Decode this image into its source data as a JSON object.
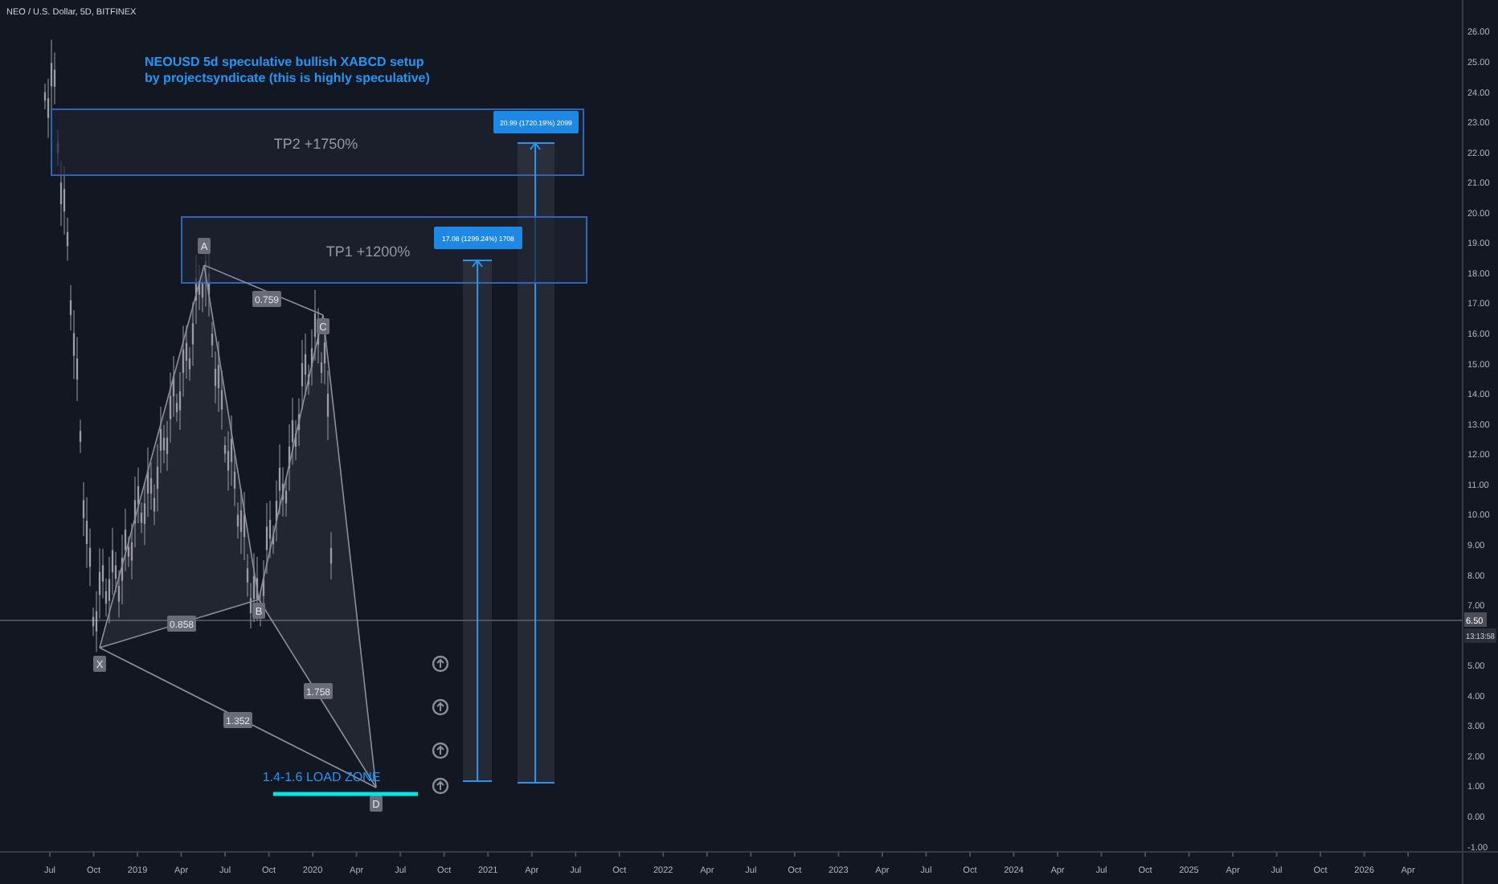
{
  "symbol": "NEO / U.S. Dollar, 5D, BITFINEX",
  "idea_title": [
    "NEOUSD 5d speculative bullish XABCD setup",
    "by projectsyndicate (this is highly speculative)"
  ],
  "targets": [
    {
      "label": "TP2 +1750%",
      "reading": "20.99 (1720.19%) 2099"
    },
    {
      "label": "TP1 +1200%",
      "reading": "17.08 (1299.24%) 1708"
    }
  ],
  "pattern_points": [
    "X",
    "A",
    "B",
    "C",
    "D"
  ],
  "ratios": [
    "0.759",
    "0.858",
    "1.758",
    "1.352"
  ],
  "zone_label": "1.4-1.6 LOAD ZONE",
  "price_axis": {
    "ticks": [
      "26.00",
      "25.00",
      "24.00",
      "23.00",
      "22.00",
      "21.00",
      "20.00",
      "19.00",
      "18.00",
      "17.00",
      "16.00",
      "15.00",
      "14.00",
      "13.00",
      "12.00",
      "11.00",
      "10.00",
      "9.00",
      "8.00",
      "7.00",
      "5.00",
      "4.00",
      "3.00",
      "2.00",
      "1.00",
      "0.00",
      "-1.00"
    ],
    "last_price": "6.50",
    "countdown": "13:13:58"
  },
  "time_axis": [
    "Jul",
    "Oct",
    "2019",
    "Apr",
    "Jul",
    "Oct",
    "2020",
    "Apr",
    "Jul",
    "Oct",
    "2021",
    "Apr",
    "Jul",
    "Oct",
    "2022",
    "Apr",
    "Jul",
    "Oct",
    "2023",
    "Apr",
    "Jul",
    "Oct",
    "2024",
    "Apr",
    "Jul",
    "Oct",
    "2025",
    "Apr",
    "Jul",
    "Oct",
    "2026",
    "Apr"
  ]
}
